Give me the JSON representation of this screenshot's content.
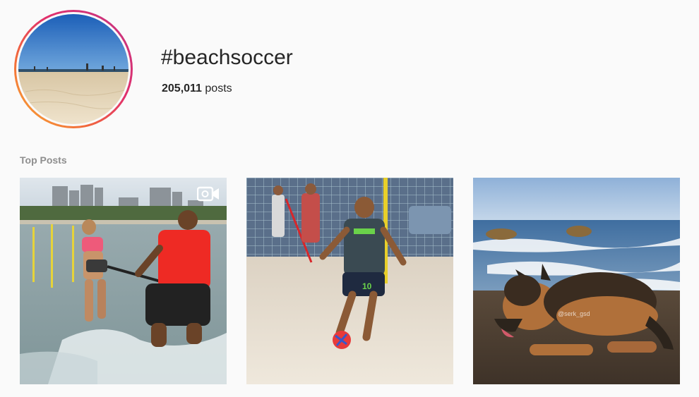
{
  "header": {
    "hashtag": "#beachsoccer",
    "post_count": "205,011",
    "post_count_suffix": " posts"
  },
  "sections": {
    "top_posts_label": "Top Posts"
  },
  "posts": [
    {
      "kind": "video",
      "icon": "video-icon",
      "subject": "woman-running-in-water-with-resistance-band"
    },
    {
      "kind": "photo",
      "subject": "beach-soccer-player-dribbling",
      "jersey_number": "10"
    },
    {
      "kind": "photo",
      "subject": "german-shepherd-on-beach",
      "watermark": "@serk_gsd"
    }
  ],
  "colors": {
    "ring_gradient": [
      "#f9b233",
      "#f26b3a",
      "#e1306c",
      "#c13584"
    ],
    "secondary_text": "#8e8e8e",
    "background": "#fafafa"
  }
}
